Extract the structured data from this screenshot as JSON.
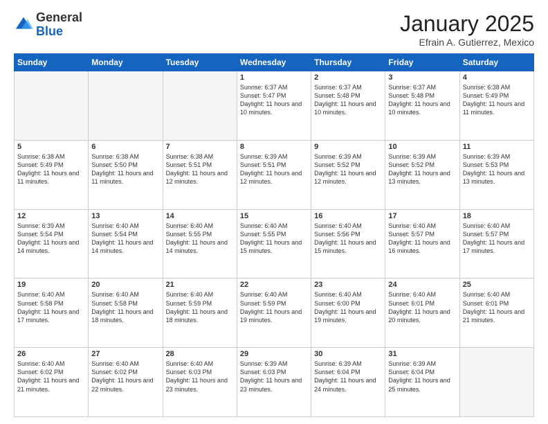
{
  "logo": {
    "general": "General",
    "blue": "Blue"
  },
  "header": {
    "month_year": "January 2025",
    "subtitle": "Efrain A. Gutierrez, Mexico"
  },
  "weekdays": [
    "Sunday",
    "Monday",
    "Tuesday",
    "Wednesday",
    "Thursday",
    "Friday",
    "Saturday"
  ],
  "weeks": [
    [
      {
        "day": "",
        "empty": true
      },
      {
        "day": "",
        "empty": true
      },
      {
        "day": "",
        "empty": true
      },
      {
        "day": "1",
        "sunrise": "6:37 AM",
        "sunset": "5:47 PM",
        "daylight": "11 hours and 10 minutes."
      },
      {
        "day": "2",
        "sunrise": "6:37 AM",
        "sunset": "5:48 PM",
        "daylight": "11 hours and 10 minutes."
      },
      {
        "day": "3",
        "sunrise": "6:37 AM",
        "sunset": "5:48 PM",
        "daylight": "11 hours and 10 minutes."
      },
      {
        "day": "4",
        "sunrise": "6:38 AM",
        "sunset": "5:49 PM",
        "daylight": "11 hours and 11 minutes."
      }
    ],
    [
      {
        "day": "5",
        "sunrise": "6:38 AM",
        "sunset": "5:49 PM",
        "daylight": "11 hours and 11 minutes."
      },
      {
        "day": "6",
        "sunrise": "6:38 AM",
        "sunset": "5:50 PM",
        "daylight": "11 hours and 11 minutes."
      },
      {
        "day": "7",
        "sunrise": "6:38 AM",
        "sunset": "5:51 PM",
        "daylight": "11 hours and 12 minutes."
      },
      {
        "day": "8",
        "sunrise": "6:39 AM",
        "sunset": "5:51 PM",
        "daylight": "11 hours and 12 minutes."
      },
      {
        "day": "9",
        "sunrise": "6:39 AM",
        "sunset": "5:52 PM",
        "daylight": "11 hours and 12 minutes."
      },
      {
        "day": "10",
        "sunrise": "6:39 AM",
        "sunset": "5:52 PM",
        "daylight": "11 hours and 13 minutes."
      },
      {
        "day": "11",
        "sunrise": "6:39 AM",
        "sunset": "5:53 PM",
        "daylight": "11 hours and 13 minutes."
      }
    ],
    [
      {
        "day": "12",
        "sunrise": "6:39 AM",
        "sunset": "5:54 PM",
        "daylight": "11 hours and 14 minutes."
      },
      {
        "day": "13",
        "sunrise": "6:40 AM",
        "sunset": "5:54 PM",
        "daylight": "11 hours and 14 minutes."
      },
      {
        "day": "14",
        "sunrise": "6:40 AM",
        "sunset": "5:55 PM",
        "daylight": "11 hours and 14 minutes."
      },
      {
        "day": "15",
        "sunrise": "6:40 AM",
        "sunset": "5:55 PM",
        "daylight": "11 hours and 15 minutes."
      },
      {
        "day": "16",
        "sunrise": "6:40 AM",
        "sunset": "5:56 PM",
        "daylight": "11 hours and 15 minutes."
      },
      {
        "day": "17",
        "sunrise": "6:40 AM",
        "sunset": "5:57 PM",
        "daylight": "11 hours and 16 minutes."
      },
      {
        "day": "18",
        "sunrise": "6:40 AM",
        "sunset": "5:57 PM",
        "daylight": "11 hours and 17 minutes."
      }
    ],
    [
      {
        "day": "19",
        "sunrise": "6:40 AM",
        "sunset": "5:58 PM",
        "daylight": "11 hours and 17 minutes."
      },
      {
        "day": "20",
        "sunrise": "6:40 AM",
        "sunset": "5:58 PM",
        "daylight": "11 hours and 18 minutes."
      },
      {
        "day": "21",
        "sunrise": "6:40 AM",
        "sunset": "5:59 PM",
        "daylight": "11 hours and 18 minutes."
      },
      {
        "day": "22",
        "sunrise": "6:40 AM",
        "sunset": "5:59 PM",
        "daylight": "11 hours and 19 minutes."
      },
      {
        "day": "23",
        "sunrise": "6:40 AM",
        "sunset": "6:00 PM",
        "daylight": "11 hours and 19 minutes."
      },
      {
        "day": "24",
        "sunrise": "6:40 AM",
        "sunset": "6:01 PM",
        "daylight": "11 hours and 20 minutes."
      },
      {
        "day": "25",
        "sunrise": "6:40 AM",
        "sunset": "6:01 PM",
        "daylight": "11 hours and 21 minutes."
      }
    ],
    [
      {
        "day": "26",
        "sunrise": "6:40 AM",
        "sunset": "6:02 PM",
        "daylight": "11 hours and 21 minutes."
      },
      {
        "day": "27",
        "sunrise": "6:40 AM",
        "sunset": "6:02 PM",
        "daylight": "11 hours and 22 minutes."
      },
      {
        "day": "28",
        "sunrise": "6:40 AM",
        "sunset": "6:03 PM",
        "daylight": "11 hours and 23 minutes."
      },
      {
        "day": "29",
        "sunrise": "6:39 AM",
        "sunset": "6:03 PM",
        "daylight": "11 hours and 23 minutes."
      },
      {
        "day": "30",
        "sunrise": "6:39 AM",
        "sunset": "6:04 PM",
        "daylight": "11 hours and 24 minutes."
      },
      {
        "day": "31",
        "sunrise": "6:39 AM",
        "sunset": "6:04 PM",
        "daylight": "11 hours and 25 minutes."
      },
      {
        "day": "",
        "empty": true
      }
    ]
  ],
  "labels": {
    "sunrise": "Sunrise:",
    "sunset": "Sunset:",
    "daylight": "Daylight:"
  }
}
